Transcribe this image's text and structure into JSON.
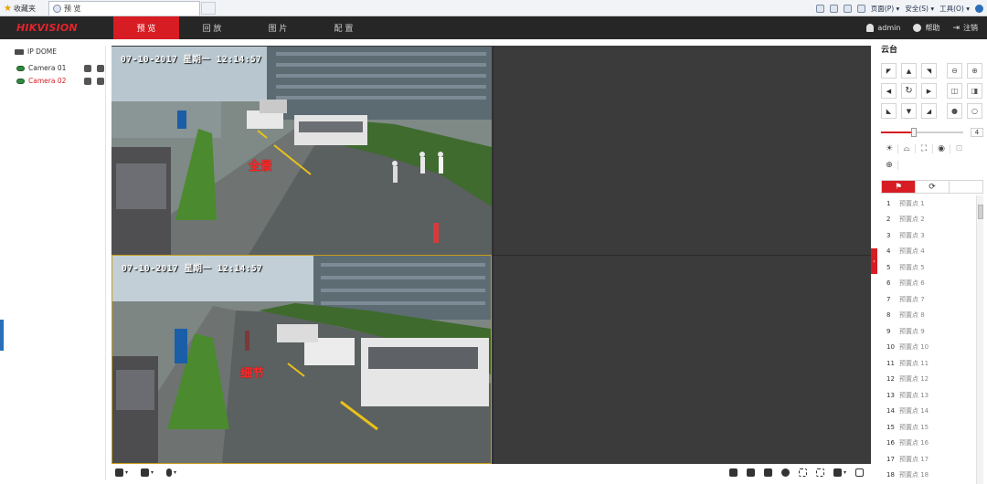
{
  "browser": {
    "favorites_label": "收藏夹",
    "tab_title": "预 览",
    "right_menu": [
      "页面(P) ▾",
      "安全(S) ▾",
      "工具(O) ▾"
    ]
  },
  "header": {
    "logo_main": "HIK",
    "logo_rest": "VISION",
    "nav": [
      {
        "label": "预 览",
        "active": true
      },
      {
        "label": "回 放",
        "active": false
      },
      {
        "label": "图 片",
        "active": false
      },
      {
        "label": "配 置",
        "active": false
      }
    ],
    "user": "admin",
    "help": "帮助",
    "logout": "注销"
  },
  "sidebar": {
    "root_label": "IP DOME",
    "cameras": [
      {
        "label": "Camera 01",
        "color": "#333333"
      },
      {
        "label": "Camera 02",
        "color": "#d71c23"
      }
    ]
  },
  "video": {
    "panes": [
      {
        "osd": "07-10-2017 星期一 12:14:57",
        "label": "全景"
      },
      {
        "osd": "07-10-2017 星期一 12:14:57",
        "label": "细节"
      }
    ],
    "collapse_glyph": "›"
  },
  "ptz": {
    "title": "云台",
    "speed_value": "4",
    "speed_level_fraction": 0.4,
    "presets": [
      {
        "num": "1",
        "name": "预置点 1"
      },
      {
        "num": "2",
        "name": "预置点 2"
      },
      {
        "num": "3",
        "name": "预置点 3"
      },
      {
        "num": "4",
        "name": "预置点 4"
      },
      {
        "num": "5",
        "name": "预置点 5"
      },
      {
        "num": "6",
        "name": "预置点 6"
      },
      {
        "num": "7",
        "name": "预置点 7"
      },
      {
        "num": "8",
        "name": "预置点 8"
      },
      {
        "num": "9",
        "name": "预置点 9"
      },
      {
        "num": "10",
        "name": "预置点 10"
      },
      {
        "num": "11",
        "name": "预置点 11"
      },
      {
        "num": "12",
        "name": "预置点 12"
      },
      {
        "num": "13",
        "name": "预置点 13"
      },
      {
        "num": "14",
        "name": "预置点 14"
      },
      {
        "num": "15",
        "name": "预置点 15"
      },
      {
        "num": "16",
        "name": "预置点 16"
      },
      {
        "num": "17",
        "name": "预置点 17"
      },
      {
        "num": "18",
        "name": "预置点 18"
      }
    ]
  },
  "colors": {
    "accent": "#d71c23",
    "header_bg": "#262626"
  }
}
